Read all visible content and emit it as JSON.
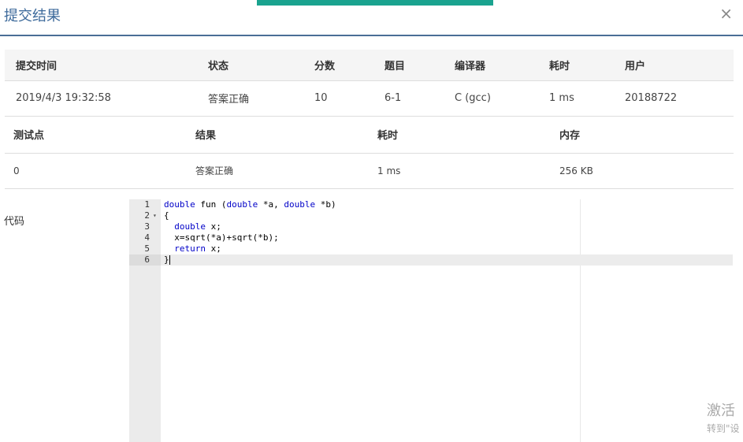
{
  "dialog": {
    "title": "提交结果",
    "close_glyph": "×"
  },
  "submission": {
    "headers": [
      "提交时间",
      "状态",
      "分数",
      "题目",
      "编译器",
      "耗时",
      "用户"
    ],
    "row": {
      "time": "2019/4/3 19:32:58",
      "status": "答案正确",
      "score": "10",
      "problem": "6-1",
      "compiler": "C (gcc)",
      "elapsed": "1 ms",
      "user": "20188722"
    }
  },
  "testpoints": {
    "headers": [
      "测试点",
      "结果",
      "耗时",
      "内存"
    ],
    "rows": [
      {
        "id": "0",
        "result": "答案正确",
        "elapsed": "1 ms",
        "memory": "256 KB"
      }
    ]
  },
  "code": {
    "label": "代码",
    "line_numbers": [
      "1",
      "2",
      "3",
      "4",
      "5",
      "6"
    ],
    "lines": [
      "double fun (double *a, double *b)",
      "{",
      "  double x;",
      "  x=sqrt(*a)+sqrt(*b);",
      "  return x;",
      "}"
    ]
  },
  "watermark": {
    "line1": "激活",
    "line2": "转到\"设"
  },
  "colors": {
    "accent_bar": "#1aa38f",
    "title": "#3d6a9b",
    "status_ok": "#d04a35",
    "link": "#2b6aa8",
    "keyword": "#0000c8"
  }
}
